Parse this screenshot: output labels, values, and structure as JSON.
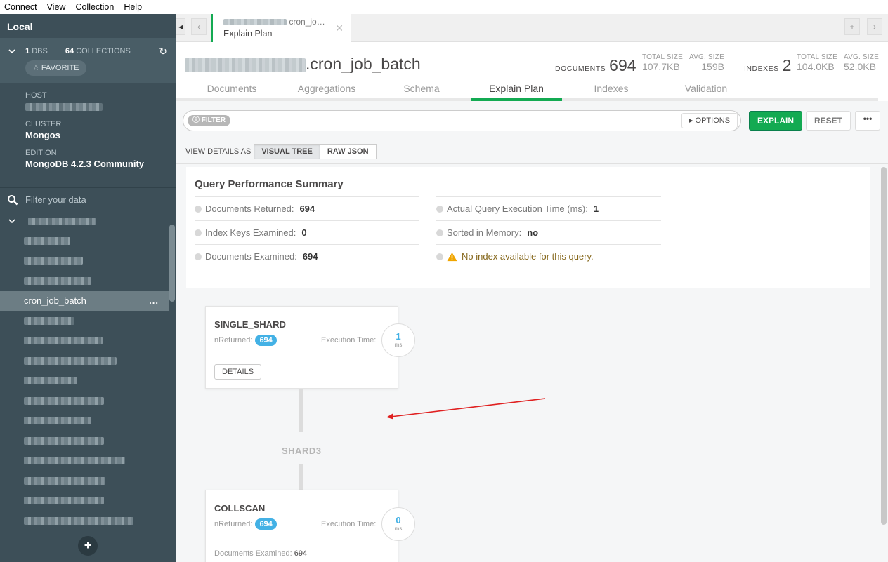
{
  "menu": [
    "Connect",
    "View",
    "Collection",
    "Help"
  ],
  "sidebar": {
    "title": "Local",
    "dbs_count": "1",
    "dbs_label": "DBS",
    "collections_count": "64",
    "collections_label": "COLLECTIONS",
    "favorite_label": "☆ FAVORITE",
    "host_label": "HOST",
    "cluster_label": "CLUSTER",
    "cluster_value": "Mongos",
    "edition_label": "EDITION",
    "edition_value": "MongoDB 4.2.3 Community",
    "filter_placeholder": "Filter your data",
    "active_collection": "cron_job_batch",
    "active_dots": "..."
  },
  "tab": {
    "ns_short": "cron_jo…",
    "title": "Explain Plan"
  },
  "header": {
    "collection": ".cron_job_batch",
    "documents_label": "DOCUMENTS",
    "documents_value": "694",
    "total_size_label": "TOTAL SIZE",
    "total_size_value": "107.7KB",
    "avg_size_label": "AVG. SIZE",
    "avg_size_value": "159B",
    "indexes_label": "INDEXES",
    "indexes_value": "2",
    "idx_total_size_label": "TOTAL SIZE",
    "idx_total_size_value": "104.0KB",
    "idx_avg_size_label": "AVG. SIZE",
    "idx_avg_size_value": "52.0KB"
  },
  "subtabs": [
    "Documents",
    "Aggregations",
    "Schema",
    "Explain Plan",
    "Indexes",
    "Validation"
  ],
  "toolbar": {
    "filter_pill": "FILTER",
    "options_label": "OPTIONS",
    "explain_label": "EXPLAIN",
    "reset_label": "RESET",
    "more_label": "•••",
    "view_as_label": "VIEW DETAILS AS",
    "visual_tree_label": "VISUAL TREE",
    "raw_json_label": "RAW JSON"
  },
  "summary": {
    "title": "Query Performance Summary",
    "docs_returned_label": "Documents Returned:",
    "docs_returned_value": "694",
    "keys_examined_label": "Index Keys Examined:",
    "keys_examined_value": "0",
    "docs_examined_label": "Documents Examined:",
    "docs_examined_value": "694",
    "exec_time_label": "Actual Query Execution Time (ms):",
    "exec_time_value": "1",
    "sorted_label": "Sorted in Memory:",
    "sorted_value": "no",
    "warning": "No index available for this query."
  },
  "stages": {
    "single_shard": {
      "title": "SINGLE_SHARD",
      "nreturned_label": "nReturned:",
      "nreturned_value": "694",
      "exec_label": "Execution Time:",
      "exec_value": "1",
      "exec_unit": "ms",
      "details_label": "DETAILS"
    },
    "shard_label": "SHARD3",
    "collscan": {
      "title": "COLLSCAN",
      "nreturned_label": "nReturned:",
      "nreturned_value": "694",
      "exec_label": "Execution Time:",
      "exec_value": "0",
      "exec_unit": "ms",
      "docs_examined_label": "Documents Examined:",
      "docs_examined_value": "694"
    }
  },
  "colors": {
    "accent_green": "#13aa52",
    "sidebar_bg": "#3d4f58",
    "pill_blue": "#43b1e5",
    "annotation_arrow": "#e02020"
  }
}
